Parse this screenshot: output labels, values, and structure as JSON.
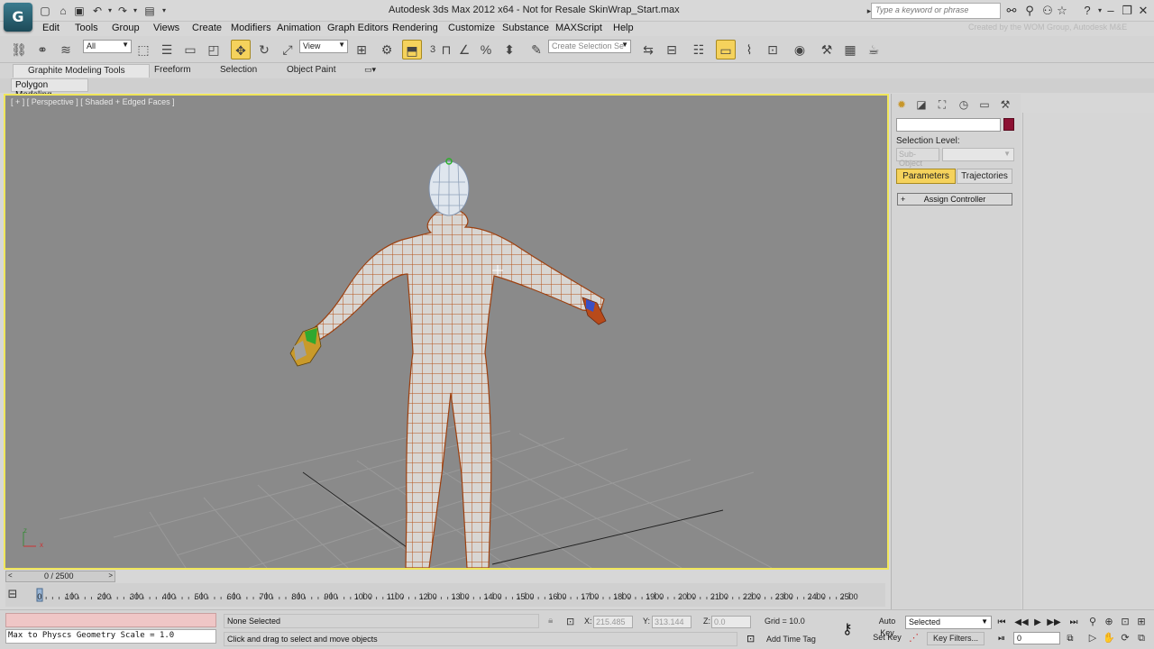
{
  "app": {
    "title": "Autodesk 3ds Max  2012 x64    -  Not for Resale     SkinWrap_Start.max",
    "logo_letter": "G",
    "search_placeholder": "Type a keyword or phrase",
    "credit_text": "Created by the WOM Group, Autodesk M&E"
  },
  "menu": [
    "Edit",
    "Tools",
    "Group",
    "Views",
    "Create",
    "Modifiers",
    "Animation",
    "Graph Editors",
    "Rendering",
    "Customize",
    "Substance",
    "MAXScript",
    "Help"
  ],
  "toolbar": {
    "selection_filter": "All",
    "reference_coord": "View",
    "named_selection_placeholder": "Create Selection Se",
    "snap_number": "3",
    "active_tool": "select-and-move"
  },
  "ribbon": {
    "tabs": [
      "Graphite Modeling Tools",
      "Freeform",
      "Selection",
      "Object Paint"
    ],
    "panel_label": "Polygon Modeling"
  },
  "viewport": {
    "label": "[ + ] [ Perspective ] [ Shaded + Edged Faces ]",
    "border_color": "#f0e65b",
    "background": "#8a8a8a",
    "axis_labels": [
      "z",
      "x"
    ]
  },
  "command_panel": {
    "selection_level_label": "Selection Level:",
    "subobject_label": "Sub-Object",
    "tabs": [
      "Parameters",
      "Trajectories"
    ],
    "active_tab": "Parameters",
    "rollout_label": "Assign Controller",
    "object_color": "#8c1032"
  },
  "timeline": {
    "slider_label": "0 / 2500",
    "ticks": [
      "0",
      "100",
      "200",
      "300",
      "400",
      "500",
      "600",
      "700",
      "800",
      "900",
      "1000",
      "1100",
      "1200",
      "1300",
      "1400",
      "1500",
      "1600",
      "1700",
      "1800",
      "1900",
      "2000",
      "2100",
      "2200",
      "2300",
      "2400",
      "2500"
    ],
    "current_frame": 0,
    "total_frames": 2500
  },
  "status": {
    "maxscript_output": "Max to Physcs Geometry Scale = 1.0",
    "selection_text": "None Selected",
    "prompt_text": "Click and drag to select and move objects",
    "x_label": "X:",
    "x_value": "215.485",
    "y_label": "Y:",
    "y_value": "313.144",
    "z_label": "Z:",
    "z_value": "0.0",
    "grid_text": "Grid = 10.0",
    "add_time_tag": "Add Time Tag",
    "auto_key": "Auto Key",
    "set_key": "Set Key",
    "key_mode": "Selected",
    "key_filters": "Key Filters...",
    "frame_value": "0"
  }
}
